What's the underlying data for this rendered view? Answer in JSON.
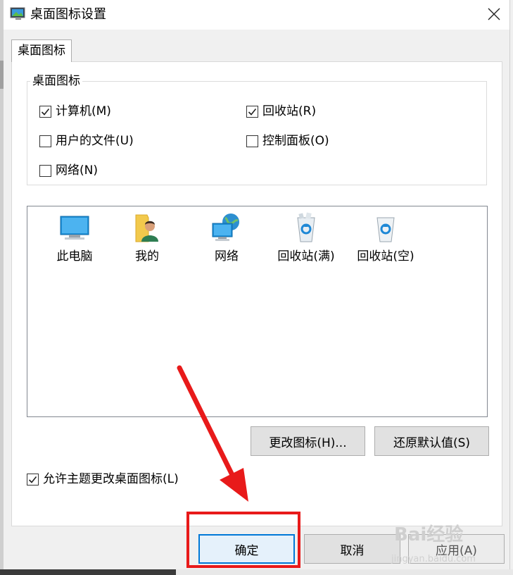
{
  "window": {
    "title": "桌面图标设置"
  },
  "tab": {
    "label": "桌面图标"
  },
  "group": {
    "legend": "桌面图标",
    "checkboxes": [
      {
        "label": "计算机(M)",
        "checked": true
      },
      {
        "label": "回收站(R)",
        "checked": true
      },
      {
        "label": "用户的文件(U)",
        "checked": false
      },
      {
        "label": "控制面板(O)",
        "checked": false
      },
      {
        "label": "网络(N)",
        "checked": false
      }
    ]
  },
  "icons": [
    {
      "label": "此电脑",
      "icon": "this-pc-icon"
    },
    {
      "label": "我的",
      "icon": "user-folder-icon"
    },
    {
      "label": "网络",
      "icon": "network-icon"
    },
    {
      "label": "回收站(满)",
      "icon": "recycle-bin-full-icon"
    },
    {
      "label": "回收站(空)",
      "icon": "recycle-bin-empty-icon"
    }
  ],
  "buttons": {
    "change_icon": "更改图标(H)...",
    "restore_default": "还原默认值(S)",
    "ok": "确定",
    "cancel": "取消",
    "apply": "应用(A)"
  },
  "allow_themes": {
    "label": "允许主题更改桌面图标(L)",
    "checked": true
  },
  "watermark": {
    "main": "Bai经验",
    "sub": "jingyan.baidu.com"
  },
  "colors": {
    "highlight": "#e81a1a",
    "accent": "#0078d7"
  }
}
